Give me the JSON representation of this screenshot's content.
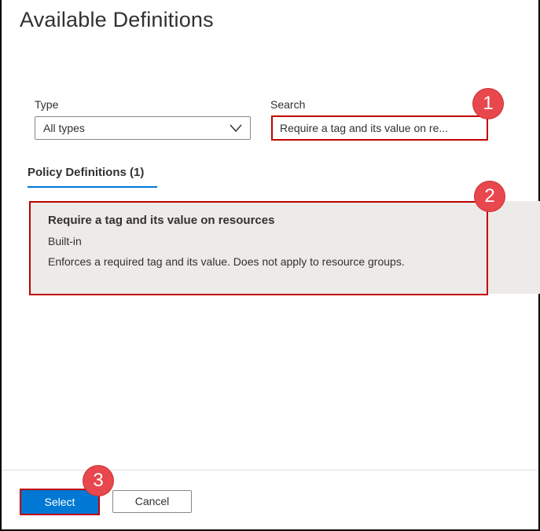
{
  "header": {
    "title": "Available Definitions"
  },
  "filters": {
    "type_label": "Type",
    "type_value": "All types",
    "search_label": "Search",
    "search_value": "Require a tag and its value on re..."
  },
  "tabs": [
    {
      "label": "Policy Definitions (1)"
    }
  ],
  "results": [
    {
      "title": "Require a tag and its value on resources",
      "type": "Built-in",
      "description": "Enforces a required tag and its value. Does not apply to resource groups."
    }
  ],
  "footer": {
    "select_label": "Select",
    "cancel_label": "Cancel"
  },
  "callouts": [
    "1",
    "2",
    "3"
  ],
  "colors": {
    "accent": "#0078d4",
    "highlight_border": "#c00000",
    "badge": "#e8474d",
    "selected_row": "#edebe9"
  }
}
